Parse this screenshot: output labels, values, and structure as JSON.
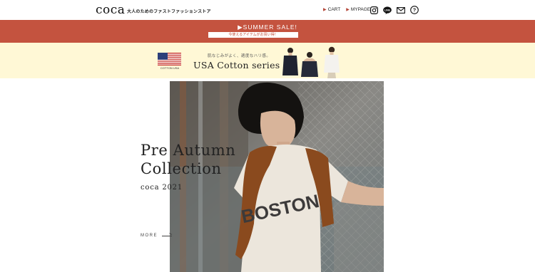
{
  "header": {
    "logo": "coca",
    "tagline": "大人のためのファストファッションストア",
    "nav": [
      {
        "label": "CART"
      },
      {
        "label": "MYPAGE"
      }
    ],
    "icons": [
      "instagram-icon",
      "line-icon",
      "mail-icon",
      "help-icon"
    ]
  },
  "sale": {
    "title": "▶SUMMER SALE!",
    "subtitle": "今使えるアイテムがお買い得！"
  },
  "cotton": {
    "flag_label": "COTTON USA",
    "tagline": "肌なじみがよく、適度なハリ感。",
    "title": "USA Cotton series"
  },
  "hero": {
    "title_line1": "Pre Autumn",
    "title_line2": "Collection",
    "subtitle": "coca 2021",
    "more_label": "MORE",
    "shirt_text": "BOSTON"
  },
  "colors": {
    "sale_red": "#c4533f",
    "cotton_bg": "#fff8d6"
  }
}
